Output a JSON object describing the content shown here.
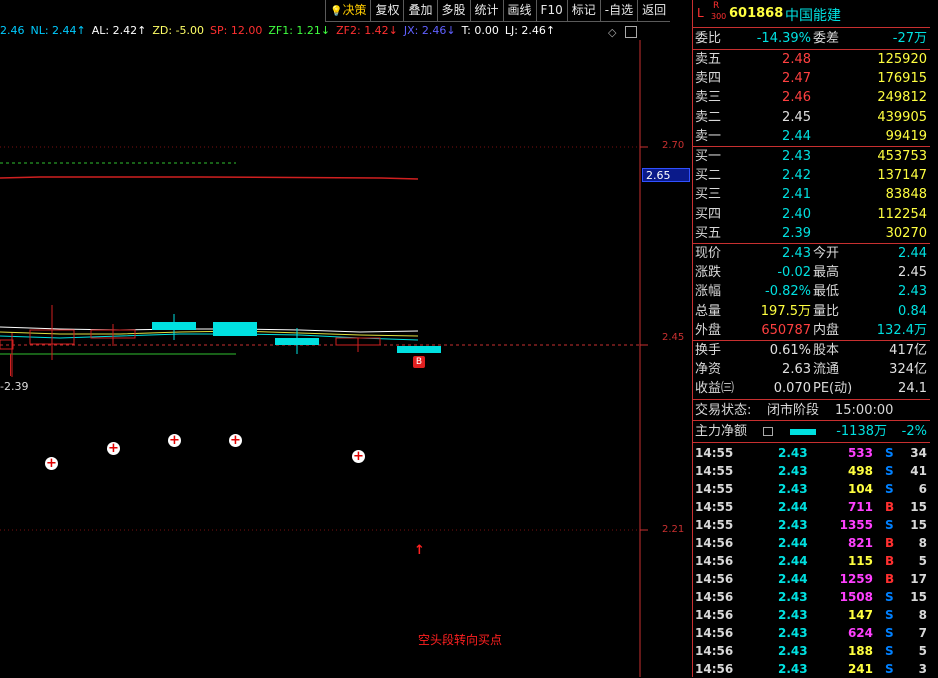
{
  "toolbar": {
    "items": [
      "决策",
      "复权",
      "叠加",
      "多股",
      "统计",
      "画线",
      "F10",
      "标记",
      "-自选",
      "返回"
    ]
  },
  "indicators": [
    {
      "text": "2.46",
      "color": "#00ccff"
    },
    {
      "text": "NL: 2.44↑",
      "color": "#00ccff"
    },
    {
      "text": "AL: 2.42↑",
      "color": "#ffffff"
    },
    {
      "text": "ZD: -5.00",
      "color": "#ffff66"
    },
    {
      "text": "SP: 12.00",
      "color": "#ff3030"
    },
    {
      "text": "ZF1: 1.21↓",
      "color": "#40ff40"
    },
    {
      "text": "ZF2: 1.42↓",
      "color": "#ff3030"
    },
    {
      "text": "JX: 2.46↓",
      "color": "#6060ff"
    },
    {
      "text": "T: 0.00",
      "color": "#ffffff"
    },
    {
      "text": "LJ: 2.46↑",
      "color": "#ffffff"
    }
  ],
  "price_axis": {
    "p270": "2.70",
    "p245": "2.45",
    "p221": "2.21",
    "current": "2.65"
  },
  "low_label": "2.39",
  "signal_text": "空头段转向买点",
  "candle_marker": "B",
  "stock": {
    "prefix": "L",
    "badge_top": "R",
    "badge_bottom": "300",
    "code": "601868",
    "name": "中国能建"
  },
  "order_ratio": {
    "label": "委比",
    "value": "-14.39%",
    "label2": "委差",
    "value2": "-27万"
  },
  "sells": [
    {
      "label": "卖五",
      "price": "2.48",
      "vol": "125920",
      "pcolor": "#ff4040"
    },
    {
      "label": "卖四",
      "price": "2.47",
      "vol": "176915",
      "pcolor": "#ff4040"
    },
    {
      "label": "卖三",
      "price": "2.46",
      "vol": "249812",
      "pcolor": "#ff4040"
    },
    {
      "label": "卖二",
      "price": "2.45",
      "vol": "439905",
      "pcolor": "#e0e0e0"
    },
    {
      "label": "卖一",
      "price": "2.44",
      "vol": "99419",
      "pcolor": "#00e0e0"
    }
  ],
  "buys": [
    {
      "label": "买一",
      "price": "2.43",
      "vol": "453753",
      "pcolor": "#00e0e0"
    },
    {
      "label": "买二",
      "price": "2.42",
      "vol": "137147",
      "pcolor": "#00e0e0"
    },
    {
      "label": "买三",
      "price": "2.41",
      "vol": "83848",
      "pcolor": "#00e0e0"
    },
    {
      "label": "买四",
      "price": "2.40",
      "vol": "112254",
      "pcolor": "#00e0e0"
    },
    {
      "label": "买五",
      "price": "2.39",
      "vol": "30270",
      "pcolor": "#00e0e0"
    }
  ],
  "quote": [
    {
      "l1": "现价",
      "v1": "2.43",
      "c1": "#00e0e0",
      "l2": "今开",
      "v2": "2.44",
      "c2": "#00e0e0"
    },
    {
      "l1": "涨跌",
      "v1": "-0.02",
      "c1": "#00e0e0",
      "l2": "最高",
      "v2": "2.45",
      "c2": "#e0e0e0"
    },
    {
      "l1": "涨幅",
      "v1": "-0.82%",
      "c1": "#00e0e0",
      "l2": "最低",
      "v2": "2.43",
      "c2": "#00e0e0"
    },
    {
      "l1": "总量",
      "v1": "197.5万",
      "c1": "#ffff40",
      "l2": "量比",
      "v2": "0.84",
      "c2": "#00e0e0"
    },
    {
      "l1": "外盘",
      "v1": "650787",
      "c1": "#ff4040",
      "l2": "内盘",
      "v2": "132.4万",
      "c2": "#00e0e0"
    }
  ],
  "fundamentals": [
    {
      "l1": "换手",
      "v1": "0.61%",
      "l2": "股本",
      "v2": "417亿"
    },
    {
      "l1": "净资",
      "v1": "2.63",
      "l2": "流通",
      "v2": "324亿"
    },
    {
      "l1": "收益㈢",
      "v1": "0.070",
      "l2": "PE(动)",
      "v2": "24.1"
    }
  ],
  "trade_status": {
    "label": "交易状态:",
    "value": "闭市阶段",
    "time": "15:00:00"
  },
  "main_flow": {
    "label": "主力净额",
    "value": "-1138万",
    "pct": "-2%"
  },
  "ticks": [
    {
      "time": "14:55",
      "price": "2.43",
      "vol": "533",
      "dir": "S",
      "n": "34",
      "pc": "#00e0e0",
      "vc": "#ff40ff"
    },
    {
      "time": "14:55",
      "price": "2.43",
      "vol": "498",
      "dir": "S",
      "n": "41",
      "pc": "#00e0e0",
      "vc": "#ffff40"
    },
    {
      "time": "14:55",
      "price": "2.43",
      "vol": "104",
      "dir": "S",
      "n": "6",
      "pc": "#00e0e0",
      "vc": "#ffff40"
    },
    {
      "time": "14:55",
      "price": "2.44",
      "vol": "711",
      "dir": "B",
      "n": "15",
      "pc": "#00e0e0",
      "vc": "#ff40ff"
    },
    {
      "time": "14:55",
      "price": "2.43",
      "vol": "1355",
      "dir": "S",
      "n": "15",
      "pc": "#00e0e0",
      "vc": "#ff40ff"
    },
    {
      "time": "14:56",
      "price": "2.44",
      "vol": "821",
      "dir": "B",
      "n": "8",
      "pc": "#00e0e0",
      "vc": "#ff40ff"
    },
    {
      "time": "14:56",
      "price": "2.44",
      "vol": "115",
      "dir": "B",
      "n": "5",
      "pc": "#00e0e0",
      "vc": "#ffff40"
    },
    {
      "time": "14:56",
      "price": "2.44",
      "vol": "1259",
      "dir": "B",
      "n": "17",
      "pc": "#00e0e0",
      "vc": "#ff40ff"
    },
    {
      "time": "14:56",
      "price": "2.43",
      "vol": "1508",
      "dir": "S",
      "n": "15",
      "pc": "#00e0e0",
      "vc": "#ff40ff"
    },
    {
      "time": "14:56",
      "price": "2.43",
      "vol": "147",
      "dir": "S",
      "n": "8",
      "pc": "#00e0e0",
      "vc": "#ffff40"
    },
    {
      "time": "14:56",
      "price": "2.43",
      "vol": "624",
      "dir": "S",
      "n": "7",
      "pc": "#00e0e0",
      "vc": "#ff40ff"
    },
    {
      "time": "14:56",
      "price": "2.43",
      "vol": "188",
      "dir": "S",
      "n": "5",
      "pc": "#00e0e0",
      "vc": "#ffff40"
    },
    {
      "time": "14:56",
      "price": "2.43",
      "vol": "241",
      "dir": "S",
      "n": "3",
      "pc": "#00e0e0",
      "vc": "#ffff40"
    }
  ],
  "colors": {
    "up": "#ff3030",
    "down": "#00e0e0",
    "border": "#c83030",
    "buyColor": "#ff3030",
    "sellColor": "#0080ff"
  }
}
